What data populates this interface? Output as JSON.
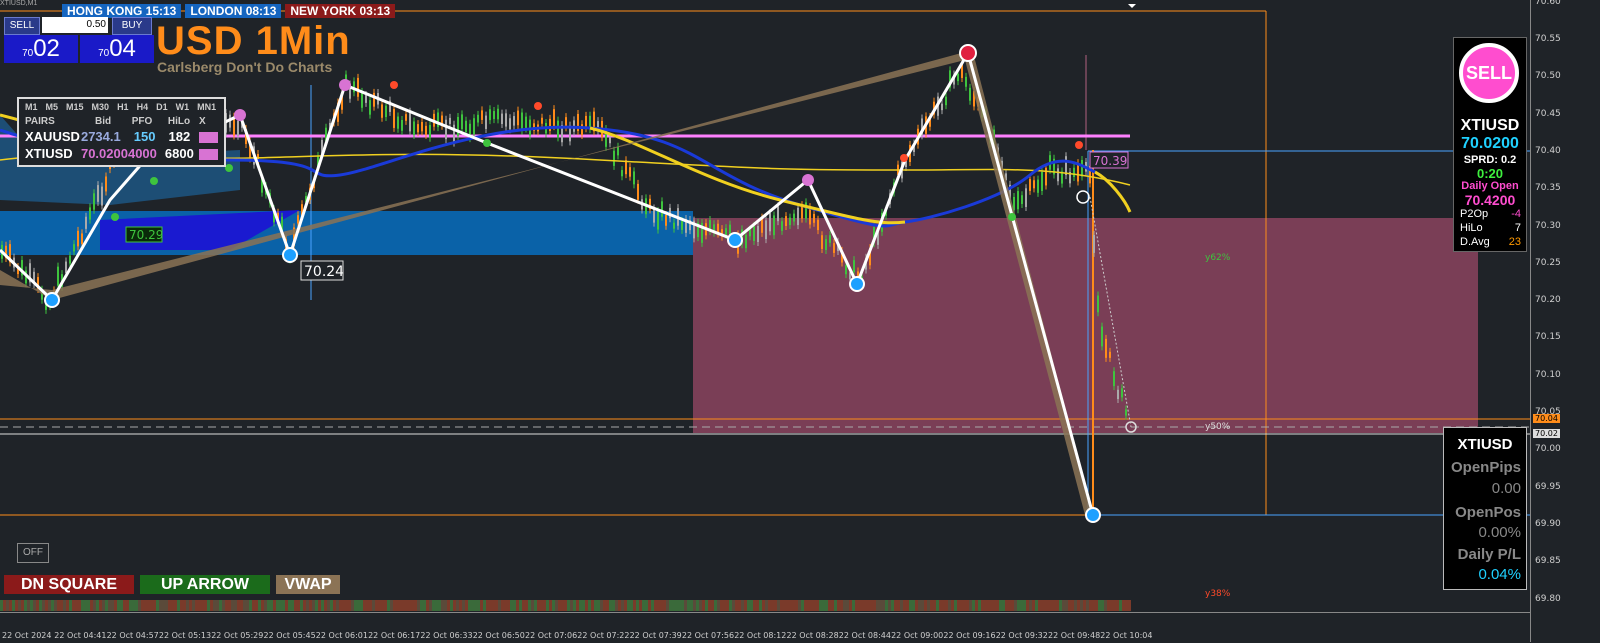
{
  "symbol_line": "XTIUSD,M1",
  "sessions": [
    {
      "label": "HONG KONG 15:13",
      "color": "#1565c0"
    },
    {
      "label": "LONDON  08:13",
      "color": "#1565c0"
    },
    {
      "label": "NEW YORK  03:13",
      "color": "#8b1a1a"
    }
  ],
  "trade_panel": {
    "sell_label": "SELL",
    "buy_label": "BUY",
    "lot": "0.50",
    "bid_small": "70",
    "bid_big": "02",
    "ask_small": "70",
    "ask_big": "04"
  },
  "title": "USD 1Min",
  "subtitle": "Carlsberg Don't Do Charts",
  "pairs_table": {
    "timeframes": [
      "M1",
      "M5",
      "M15",
      "M30",
      "H1",
      "H4",
      "D1",
      "W1",
      "MN1"
    ],
    "headers": [
      "PAIRS",
      "Bid",
      "PFO",
      "HiLo",
      "X"
    ],
    "rows": [
      {
        "pair": "XAUUSD",
        "bid": "2734.1",
        "pfo": "150",
        "hilo": "182",
        "swatch": "#d873d3"
      },
      {
        "pair": "XTIUSD",
        "bid": "70.02004000",
        "pfo": "",
        "hilo": "6800",
        "swatch": "#d873d3"
      }
    ]
  },
  "sell_box": {
    "signal": "SELL",
    "symbol": "XTIUSD",
    "price": "70.0200",
    "spread": "SPRD: 0.2",
    "timer": "0:20",
    "daily_open_label": "Daily Open",
    "daily_open": "70.4200",
    "rows": [
      {
        "k": "P2Op",
        "v": "-4",
        "color": "#ff4dcf"
      },
      {
        "k": "HiLo",
        "v": "7",
        "color": "#ffffff"
      },
      {
        "k": "D.Avg",
        "v": "23",
        "color": "#ff9900"
      }
    ]
  },
  "position_box": {
    "symbol": "XTIUSD",
    "open_pips_label": "OpenPips",
    "open_pips": "0.00",
    "open_pos_label": "OpenPos",
    "open_pos": "0.00%",
    "daily_pl_label": "Daily P/L",
    "daily_pl": "0.04%"
  },
  "off_button": "OFF",
  "legend": [
    {
      "label": "DN SQUARE",
      "color": "#8b1a1a"
    },
    {
      "label": "UP ARROW",
      "color": "#1b6b1b"
    },
    {
      "label": "VWAP",
      "color": "#8b7355"
    }
  ],
  "chart_labels": {
    "l1": "70.29",
    "l2": "70.24",
    "l3": "70.39",
    "fib62": "y62%",
    "fib50": "y50%",
    "fib38": "y38%",
    "price_tag_1": "70.04",
    "price_tag_2": "70.02"
  },
  "price_axis": [
    "70.60",
    "70.55",
    "70.50",
    "70.45",
    "70.40",
    "70.35",
    "70.30",
    "70.25",
    "70.20",
    "70.15",
    "70.10",
    "70.05",
    "70.00",
    "69.95",
    "69.90",
    "69.85",
    "69.80"
  ],
  "time_axis": [
    "22 Oct 2024",
    "22 Oct 04:41",
    "22 Oct 04:57",
    "22 Oct 05:13",
    "22 Oct 05:29",
    "22 Oct 05:45",
    "22 Oct 06:01",
    "22 Oct 06:17",
    "22 Oct 06:33",
    "22 Oct 06:50",
    "22 Oct 07:06",
    "22 Oct 07:22",
    "22 Oct 07:39",
    "22 Oct 07:56",
    "22 Oct 08:12",
    "22 Oct 08:28",
    "22 Oct 08:44",
    "22 Oct 09:00",
    "22 Oct 09:16",
    "22 Oct 09:32",
    "22 Oct 09:48",
    "22 Oct 10:04"
  ],
  "colors": {
    "bg": "#1f2328",
    "bull": "#3ec43e",
    "bear": "#ff8c1a",
    "neutral": "#aaaaaa",
    "zone_blue": "#0a62a8",
    "zone_pink": "#7a3e56",
    "ma_blue": "#1a3ad8",
    "ma_yellow": "#f0d020",
    "zigzag": "#ffffff",
    "vwap": "#8b7355",
    "pink_line": "#ff80ff"
  }
}
